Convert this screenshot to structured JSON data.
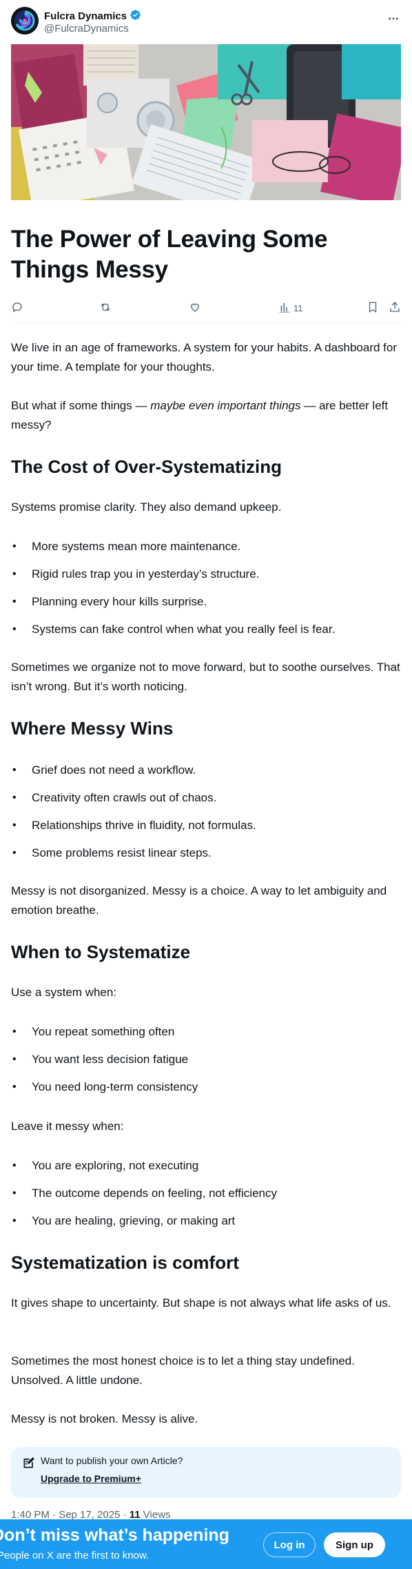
{
  "author": {
    "name": "Fulcra Dynamics",
    "handle": "@FulcraDynamics",
    "verified_color": "#1d9bf0"
  },
  "article": {
    "title": "The Power of Leaving Some Things Messy",
    "views_count": "11",
    "intro_p1": "We live in an age of frameworks. A system for your habits. A dashboard for your time. A template for your thoughts.",
    "intro_p2_before": "But what if some things — ",
    "intro_p2_italic": "maybe even important things",
    "intro_p2_after": " — are better left messy?",
    "section1": {
      "heading": "The Cost of Over-Systematizing",
      "lead": "Systems promise clarity. They also demand upkeep.",
      "items": [
        "More systems mean more maintenance.",
        "Rigid rules trap you in yesterday’s structure.",
        "Planning every hour kills surprise.",
        "Systems can fake control when what you really feel is fear."
      ],
      "closing": "Sometimes we organize not to move forward, but to soothe ourselves. That isn’t wrong. But it’s worth noticing."
    },
    "section2": {
      "heading": "Where Messy Wins",
      "items": [
        "Grief does not need a workflow.",
        "Creativity often crawls out of chaos.",
        "Relationships thrive in fluidity, not formulas.",
        "Some problems resist linear steps."
      ],
      "closing": "Messy is not disorganized. Messy is a choice. A way to let ambiguity and emotion breathe."
    },
    "section3": {
      "heading": "When to Systematize",
      "lead_use": "Use a system when:",
      "use_items": [
        "You repeat something often",
        "You want less decision fatigue",
        "You need long-term consistency"
      ],
      "lead_leave": "Leave it messy when:",
      "leave_items": [
        "You are exploring, not executing",
        "The outcome depends on feeling, not efficiency",
        "You are healing, grieving, or making art"
      ]
    },
    "section4": {
      "heading": "Systematization is comfort",
      "p1": "It gives shape to uncertainty. But shape is not always what life asks of us.",
      "p2": "Sometimes the most honest choice is to let a thing stay undefined. Unsolved. A little undone.",
      "p3": "Messy is not broken. Messy is alive."
    }
  },
  "promo": {
    "question": "Want to publish your own Article?",
    "link": "Upgrade to Premium+"
  },
  "meta": {
    "timestamp": "1:40 PM · Sep 17, 2025 · ",
    "views_number": "11",
    "views_label": " Views"
  },
  "banner": {
    "title": "Don’t miss what’s happening",
    "subtitle": "People on X are the first to know.",
    "login": "Log in",
    "signup": "Sign up",
    "bg_color": "#1d9bf0"
  }
}
